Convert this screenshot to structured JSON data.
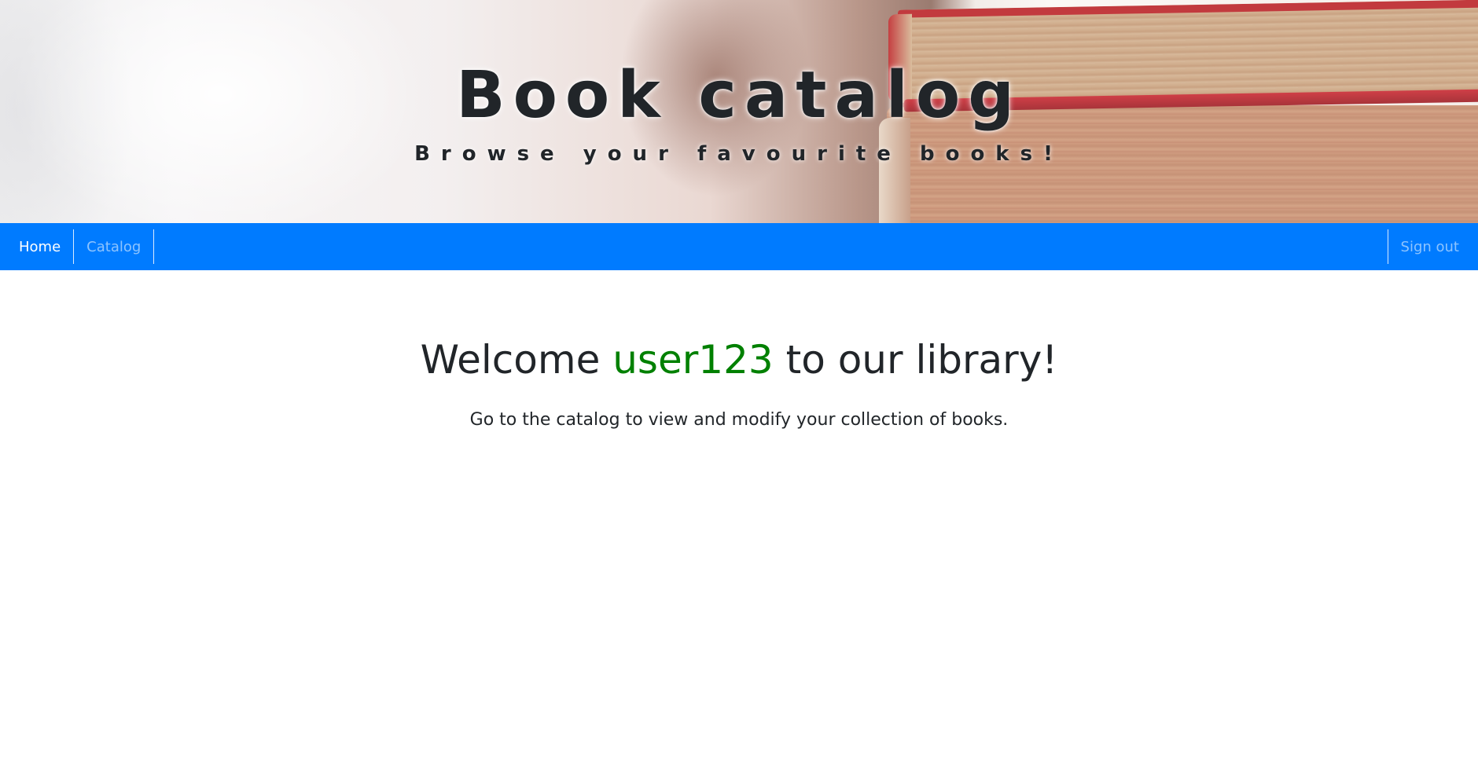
{
  "header": {
    "title": "Book catalog",
    "subtitle": "Browse your favourite books!"
  },
  "navbar": {
    "home_label": "Home",
    "catalog_label": "Catalog",
    "signout_label": "Sign out",
    "background_color": "#007bff"
  },
  "main": {
    "welcome_prefix": "Welcome ",
    "username": "user123",
    "welcome_suffix": " to our library!",
    "username_color": "#008000",
    "intro_text": "Go to the catalog to view and modify your collection of books."
  }
}
